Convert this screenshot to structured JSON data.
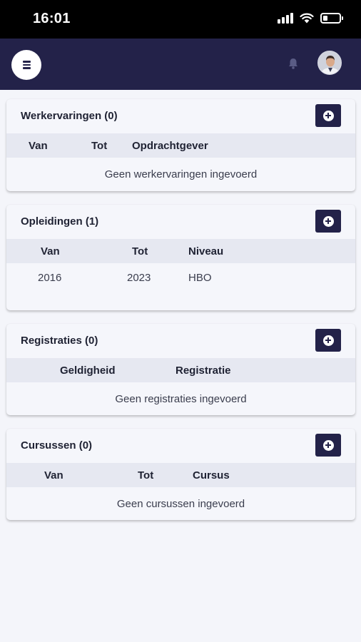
{
  "status_bar": {
    "time": "16:01"
  },
  "header": {
    "menu_icon": "hamburger-icon",
    "bell_icon": "bell-icon",
    "avatar_icon": "user-avatar"
  },
  "colors": {
    "primary": "#232249",
    "table_header": "#e6e8f1",
    "background": "#f4f5fa"
  },
  "sections": {
    "werkervaringen": {
      "title": "Werkervaringen (0)",
      "columns": [
        "Van",
        "Tot",
        "Opdrachtgever"
      ],
      "empty": "Geen werkervaringen ingevoerd"
    },
    "opleidingen": {
      "title": "Opleidingen (1)",
      "columns": [
        "Van",
        "Tot",
        "Niveau"
      ],
      "rows": [
        [
          "2016",
          "2023",
          "HBO"
        ]
      ]
    },
    "registraties": {
      "title": "Registraties (0)",
      "columns": [
        "Geldigheid",
        "Registratie"
      ],
      "empty": "Geen registraties ingevoerd"
    },
    "cursussen": {
      "title": "Cursussen (0)",
      "columns": [
        "Van",
        "Tot",
        "Cursus"
      ],
      "empty": "Geen cursussen ingevoerd"
    }
  }
}
